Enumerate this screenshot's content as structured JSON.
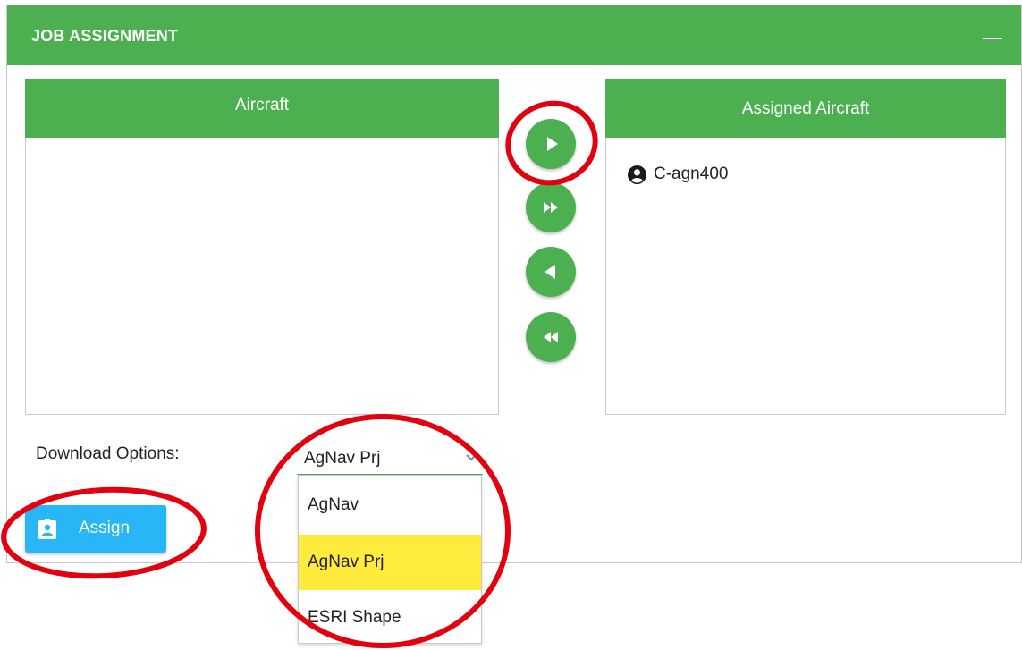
{
  "panel": {
    "title": "JOB ASSIGNMENT",
    "collapse_icon": "minus-icon"
  },
  "aircraft_list": {
    "header": "Aircraft",
    "items": []
  },
  "assigned_list": {
    "header": "Assigned Aircraft",
    "items": [
      {
        "icon": "user-circle-icon",
        "label": "C-agn400"
      }
    ]
  },
  "transfer_buttons": [
    {
      "name": "move-selected-right",
      "icon": "play-right-icon"
    },
    {
      "name": "move-all-right",
      "icon": "fast-forward-icon"
    },
    {
      "name": "move-selected-left",
      "icon": "play-left-icon"
    },
    {
      "name": "move-all-left",
      "icon": "rewind-icon"
    }
  ],
  "download": {
    "label": "Download Options:",
    "selected": "AgNav Prj",
    "options": [
      "AgNav",
      "AgNav Prj",
      "ESRI Shape"
    ],
    "highlighted_option": "AgNav Prj"
  },
  "assign_button": {
    "label": "Assign",
    "icon": "id-badge-icon"
  },
  "colors": {
    "header_green": "#4caf50",
    "assign_blue": "#29b6f6",
    "highlight_yellow": "#ffeb3b",
    "annotation_red": "#e3000f"
  }
}
